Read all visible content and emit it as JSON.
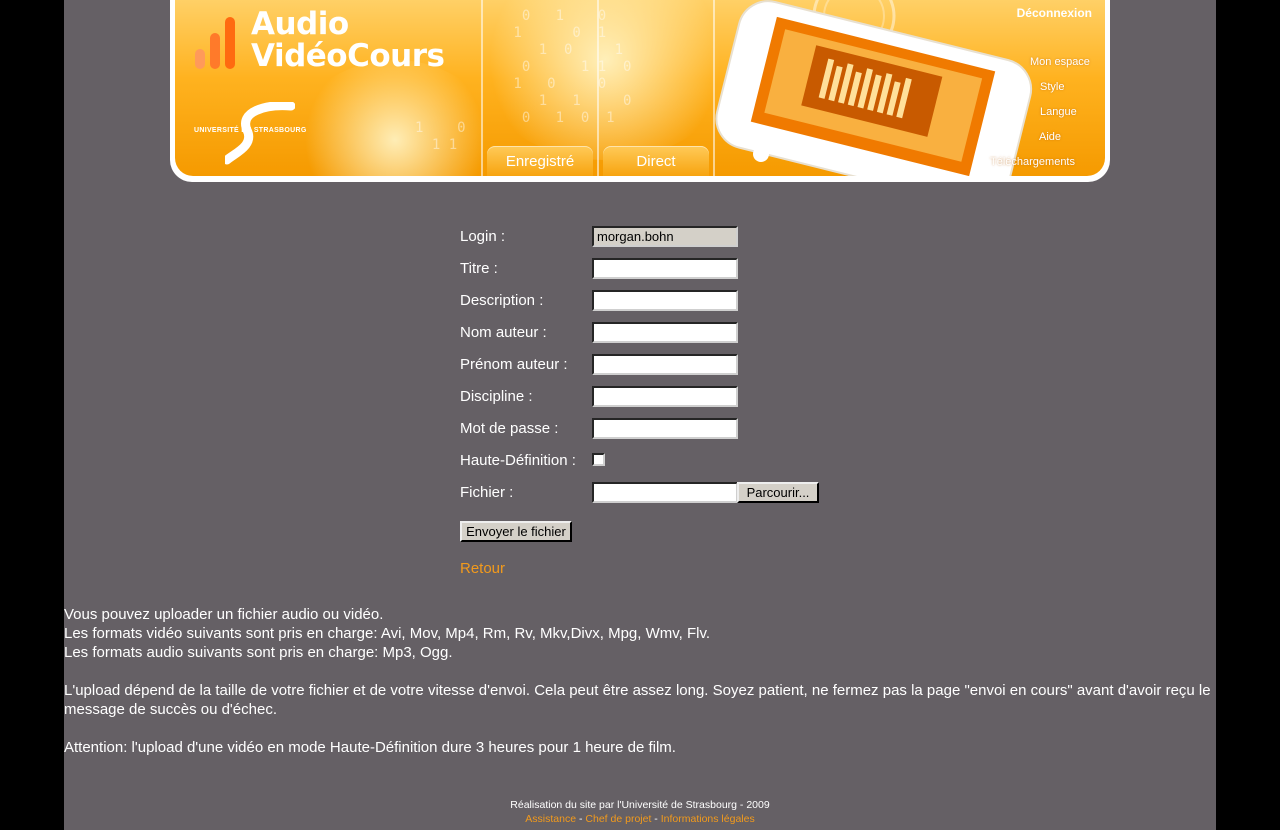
{
  "banner": {
    "logo_title_line1": "Audio",
    "logo_title_line2": "VidéoCours",
    "university": "UNIVERSITÉ DE STRASBOURG",
    "tabs": [
      {
        "label": "Enregistré"
      },
      {
        "label": "Direct"
      }
    ],
    "logout": "Déconnexion",
    "nav": [
      {
        "label": "Mon espace"
      },
      {
        "label": "Style"
      },
      {
        "label": "Langue"
      },
      {
        "label": "Aide"
      },
      {
        "label": "Téléchargements"
      }
    ]
  },
  "form": {
    "fields": [
      {
        "label": "Login :",
        "value": "morgan.bohn"
      },
      {
        "label": "Titre :",
        "value": ""
      },
      {
        "label": "Description :",
        "value": ""
      },
      {
        "label": "Nom auteur :",
        "value": ""
      },
      {
        "label": "Prénom auteur :",
        "value": ""
      },
      {
        "label": "Discipline :",
        "value": ""
      },
      {
        "label": "Mot de passe :",
        "value": ""
      }
    ],
    "hd_label": "Haute-Définition :",
    "hd_checked": false,
    "file_label": "Fichier :",
    "browse_button": "Parcourir...",
    "submit_button": "Envoyer le fichier",
    "back_link": "Retour"
  },
  "info": {
    "line1": "Vous pouvez uploader un fichier audio ou vidéo.",
    "line2": "Les formats vidéo suivants sont pris en charge: Avi, Mov, Mp4, Rm, Rv, Mkv,Divx, Mpg, Wmv, Flv.",
    "line3": "Les formats audio suivants sont pris en charge: Mp3, Ogg.",
    "paragraph": "L'upload dépend de la taille de votre fichier et de votre vitesse d'envoi. Cela peut être assez long. Soyez patient, ne fermez pas la page \"envoi en cours\" avant d'avoir reçu le message de succès ou d'échec.",
    "attention": "Attention: l'upload d'une vidéo en mode Haute-Définition dure 3 heures pour 1 heure de film."
  },
  "footer": {
    "credit": "Réalisation du site par l'Université de Strasbourg - 2009",
    "links": [
      "Assistance",
      "Chef de projet",
      "Informations légales"
    ],
    "separator": " - "
  },
  "colors": {
    "page_bg": "#656065",
    "outer_bg": "#000000",
    "accent_orange": "#f29a1c",
    "banner_orange": "#ffb21f"
  }
}
